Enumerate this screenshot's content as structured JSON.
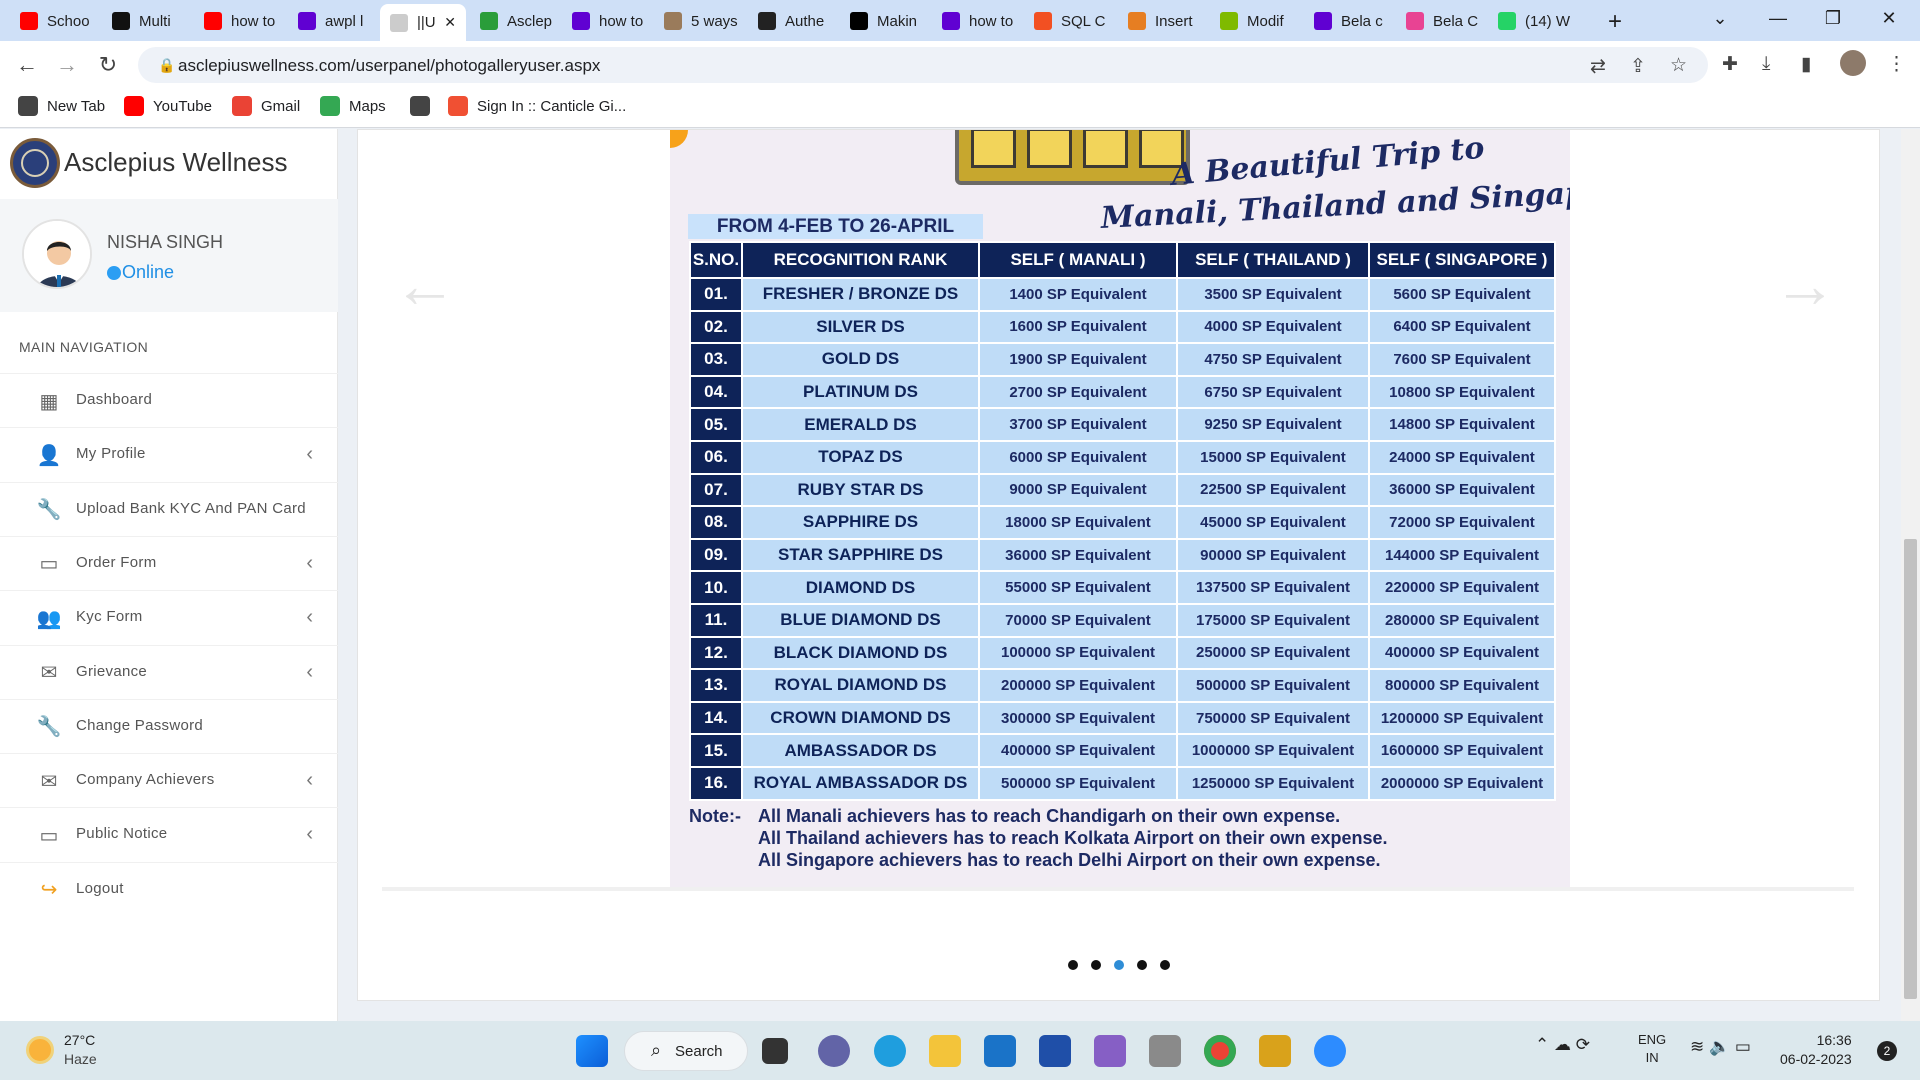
{
  "browser": {
    "tabs": [
      {
        "label": "Schoo",
        "icon": "youtube-icon",
        "color": "#ff0000"
      },
      {
        "label": "Multi",
        "icon": "x-icon",
        "color": "#111111"
      },
      {
        "label": "how to",
        "icon": "youtube-icon",
        "color": "#ff0000"
      },
      {
        "label": "awpl l",
        "icon": "yahoo-icon",
        "color": "#6001d2"
      },
      {
        "label": "||U",
        "icon": "page-icon",
        "color": "#cccccc"
      },
      {
        "label": "Asclep",
        "icon": "chart-icon",
        "color": "#2a9d3a"
      },
      {
        "label": "how to",
        "icon": "yahoo-icon",
        "color": "#6001d2"
      },
      {
        "label": "5 ways",
        "icon": "person-icon",
        "color": "#9a7b5b"
      },
      {
        "label": "Authe",
        "icon": "shield-icon",
        "color": "#222222"
      },
      {
        "label": "Makin",
        "icon": "medium-icon",
        "color": "#000000"
      },
      {
        "label": "how to",
        "icon": "yahoo-icon",
        "color": "#6001d2"
      },
      {
        "label": "SQL C",
        "icon": "sql-icon",
        "color": "#f25022"
      },
      {
        "label": "Insert",
        "icon": "edit-icon",
        "color": "#e67e22"
      },
      {
        "label": "Modif",
        "icon": "microsoft-icon",
        "color": "#7fba00"
      },
      {
        "label": "Bela c",
        "icon": "yahoo-icon",
        "color": "#6001d2"
      },
      {
        "label": "Bela C",
        "icon": "p-icon",
        "color": "#e84393"
      },
      {
        "label": "(14) W",
        "icon": "whatsapp-icon",
        "color": "#25d366"
      }
    ],
    "url": "asclepiuswellness.com/userpanel/photogalleryuser.aspx",
    "bookmarks": [
      {
        "label": "New Tab",
        "icon": "globe-icon"
      },
      {
        "label": "YouTube",
        "icon": "youtube-icon"
      },
      {
        "label": "Gmail",
        "icon": "gmail-icon"
      },
      {
        "label": "Maps",
        "icon": "maps-icon"
      },
      {
        "label": "",
        "icon": "globe-icon"
      },
      {
        "label": "Sign In :: Canticle Gi...",
        "icon": "git-icon"
      }
    ]
  },
  "sidebar": {
    "brand": "Asclepius Wellness",
    "user": {
      "name": "NISHA SINGH",
      "status": "Online"
    },
    "nav_header": "MAIN NAVIGATION",
    "items": [
      {
        "label": "Dashboard",
        "icon": "grid-icon",
        "has_chevron": false
      },
      {
        "label": "My Profile",
        "icon": "user-icon",
        "has_chevron": true
      },
      {
        "label": "Upload Bank KYC And PAN Card",
        "icon": "wrench-icon",
        "has_chevron": false
      },
      {
        "label": "Order Form",
        "icon": "card-icon",
        "has_chevron": true
      },
      {
        "label": "Kyc Form",
        "icon": "users-icon",
        "has_chevron": true
      },
      {
        "label": "Grievance",
        "icon": "envelope-icon",
        "has_chevron": true
      },
      {
        "label": "Change Password",
        "icon": "wrench-icon",
        "has_chevron": false
      },
      {
        "label": "Company Achievers",
        "icon": "envelope-icon",
        "has_chevron": true
      },
      {
        "label": "Public Notice",
        "icon": "card-icon",
        "has_chevron": true
      },
      {
        "label": "Logout",
        "icon": "logout-icon",
        "has_chevron": false
      }
    ]
  },
  "slide": {
    "subtitle_line1": "A Beautiful Trip to",
    "subtitle_line2": "Manali, Thailand and Singapore!",
    "date_range": "FROM 4-FEB TO 26-APRIL",
    "headers": [
      "S.NO.",
      "RECOGNITION RANK",
      "SELF ( MANALI )",
      "SELF ( THAILAND )",
      "SELF ( SINGAPORE )"
    ],
    "rows": [
      [
        "01.",
        "FRESHER / BRONZE DS",
        "1400 SP Equivalent",
        "3500 SP Equivalent",
        "5600 SP Equivalent"
      ],
      [
        "02.",
        "SILVER DS",
        "1600 SP Equivalent",
        "4000 SP Equivalent",
        "6400 SP Equivalent"
      ],
      [
        "03.",
        "GOLD DS",
        "1900 SP Equivalent",
        "4750 SP Equivalent",
        "7600 SP Equivalent"
      ],
      [
        "04.",
        "PLATINUM DS",
        "2700 SP Equivalent",
        "6750 SP Equivalent",
        "10800 SP Equivalent"
      ],
      [
        "05.",
        "EMERALD DS",
        "3700 SP Equivalent",
        "9250 SP Equivalent",
        "14800 SP Equivalent"
      ],
      [
        "06.",
        "TOPAZ DS",
        "6000 SP Equivalent",
        "15000 SP Equivalent",
        "24000 SP Equivalent"
      ],
      [
        "07.",
        "RUBY STAR DS",
        "9000 SP Equivalent",
        "22500 SP Equivalent",
        "36000 SP Equivalent"
      ],
      [
        "08.",
        "SAPPHIRE DS",
        "18000 SP Equivalent",
        "45000 SP Equivalent",
        "72000 SP Equivalent"
      ],
      [
        "09.",
        "STAR SAPPHIRE DS",
        "36000 SP Equivalent",
        "90000 SP Equivalent",
        "144000 SP Equivalent"
      ],
      [
        "10.",
        "DIAMOND DS",
        "55000 SP Equivalent",
        "137500 SP Equivalent",
        "220000 SP Equivalent"
      ],
      [
        "11.",
        "BLUE DIAMOND DS",
        "70000 SP Equivalent",
        "175000 SP Equivalent",
        "280000 SP Equivalent"
      ],
      [
        "12.",
        "BLACK DIAMOND DS",
        "100000 SP Equivalent",
        "250000 SP Equivalent",
        "400000 SP Equivalent"
      ],
      [
        "13.",
        "ROYAL DIAMOND DS",
        "200000 SP Equivalent",
        "500000 SP Equivalent",
        "800000 SP Equivalent"
      ],
      [
        "14.",
        "CROWN DIAMOND DS",
        "300000 SP Equivalent",
        "750000 SP Equivalent",
        "1200000 SP Equivalent"
      ],
      [
        "15.",
        "AMBASSADOR DS",
        "400000 SP Equivalent",
        "1000000 SP Equivalent",
        "1600000 SP Equivalent"
      ],
      [
        "16.",
        "ROYAL AMBASSADOR DS",
        "500000 SP Equivalent",
        "1250000 SP Equivalent",
        "2000000 SP Equivalent"
      ]
    ],
    "note_label": "Note:-",
    "notes": [
      "All Manali achievers has to reach Chandigarh on their own expense.",
      "All Thailand achievers has to reach Kolkata Airport on their own expense.",
      "All Singapore achievers has to reach Delhi Airport on their own expense."
    ]
  },
  "carousel": {
    "active_index": 2,
    "count": 5
  },
  "taskbar": {
    "temperature": "27°C",
    "condition": "Haze",
    "search_label": "Search",
    "lang_line1": "ENG",
    "lang_line2": "IN",
    "time": "16:36",
    "date": "06-02-2023",
    "notifications": "2"
  },
  "colors": {
    "navy": "#0e2358",
    "cell_blue": "#bfdcf7",
    "online_blue": "#1f8fe5",
    "tab_strip": "#cfe0f7"
  }
}
